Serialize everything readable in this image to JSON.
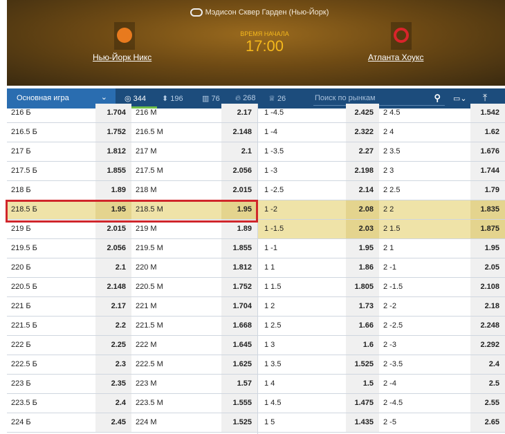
{
  "header": {
    "venue": "Мэдисон Сквер Гарден (Нью-Йорк)",
    "home_team": "Нью-Йорк Никс",
    "away_team": "Атланта Хоукс",
    "start_label": "ВРЕМЯ НАЧАЛА",
    "start_time": "17:00"
  },
  "nav": {
    "dropdown": "Основная игра",
    "stats": [
      "344",
      "196",
      "76",
      "268",
      "26"
    ],
    "search_placeholder": "Поиск по рынкам"
  },
  "colors": {
    "accent": "#f5b81c",
    "nav": "#1c4c7c",
    "highlight": "#efe3a8",
    "red_box": "#d0262b"
  },
  "rows": [
    [
      "216 Б",
      "1.704",
      "216 М",
      "2.17",
      "1 -4.5",
      "2.425",
      "2 4.5",
      "1.542"
    ],
    [
      "216.5 Б",
      "1.752",
      "216.5 М",
      "2.148",
      "1 -4",
      "2.322",
      "2 4",
      "1.62"
    ],
    [
      "217 Б",
      "1.812",
      "217 М",
      "2.1",
      "1 -3.5",
      "2.27",
      "2 3.5",
      "1.676"
    ],
    [
      "217.5 Б",
      "1.855",
      "217.5 М",
      "2.056",
      "1 -3",
      "2.198",
      "2 3",
      "1.744"
    ],
    [
      "218 Б",
      "1.89",
      "218 М",
      "2.015",
      "1 -2.5",
      "2.14",
      "2 2.5",
      "1.79"
    ],
    [
      "218.5 Б",
      "1.95",
      "218.5 М",
      "1.95",
      "1 -2",
      "2.08",
      "2 2",
      "1.835"
    ],
    [
      "219 Б",
      "2.015",
      "219 М",
      "1.89",
      "1 -1.5",
      "2.03",
      "2 1.5",
      "1.875"
    ],
    [
      "219.5 Б",
      "2.056",
      "219.5 М",
      "1.855",
      "1 -1",
      "1.95",
      "2 1",
      "1.95"
    ],
    [
      "220 Б",
      "2.1",
      "220 М",
      "1.812",
      "1 1",
      "1.86",
      "2 -1",
      "2.05"
    ],
    [
      "220.5 Б",
      "2.148",
      "220.5 М",
      "1.752",
      "1 1.5",
      "1.805",
      "2 -1.5",
      "2.108"
    ],
    [
      "221 Б",
      "2.17",
      "221 М",
      "1.704",
      "1 2",
      "1.73",
      "2 -2",
      "2.18"
    ],
    [
      "221.5 Б",
      "2.2",
      "221.5 М",
      "1.668",
      "1 2.5",
      "1.66",
      "2 -2.5",
      "2.248"
    ],
    [
      "222 Б",
      "2.25",
      "222 М",
      "1.645",
      "1 3",
      "1.6",
      "2 -3",
      "2.292"
    ],
    [
      "222.5 Б",
      "2.3",
      "222.5 М",
      "1.625",
      "1 3.5",
      "1.525",
      "2 -3.5",
      "2.4"
    ],
    [
      "223 Б",
      "2.35",
      "223 М",
      "1.57",
      "1 4",
      "1.5",
      "2 -4",
      "2.5"
    ],
    [
      "223.5 Б",
      "2.4",
      "223.5 М",
      "1.555",
      "1 4.5",
      "1.475",
      "2 -4.5",
      "2.55"
    ],
    [
      "224 Б",
      "2.45",
      "224 М",
      "1.525",
      "1 5",
      "1.435",
      "2 -5",
      "2.65"
    ]
  ],
  "highlight_left_row": 5,
  "highlight_right_row": 6
}
